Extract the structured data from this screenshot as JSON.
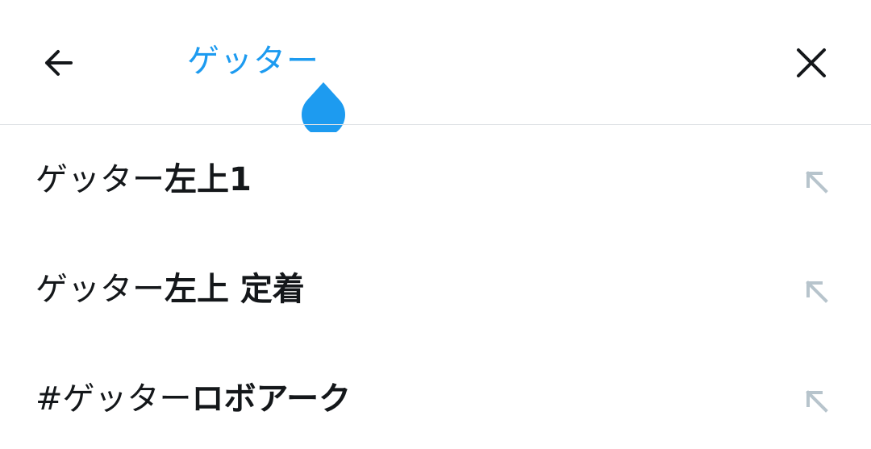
{
  "search": {
    "query": "ゲッター",
    "back_icon": "arrow-left-icon",
    "close_icon": "close-icon",
    "accent_color": "#1d9bf0"
  },
  "suggestions": [
    {
      "prefix": "ゲッター",
      "rest": "左上1",
      "fill_icon": "arrow-up-left-icon"
    },
    {
      "prefix": "ゲッター",
      "rest": "左上 定着",
      "fill_icon": "arrow-up-left-icon"
    },
    {
      "prefix": "#ゲッター",
      "rest": "ロボアーク",
      "fill_icon": "arrow-up-left-icon"
    }
  ]
}
